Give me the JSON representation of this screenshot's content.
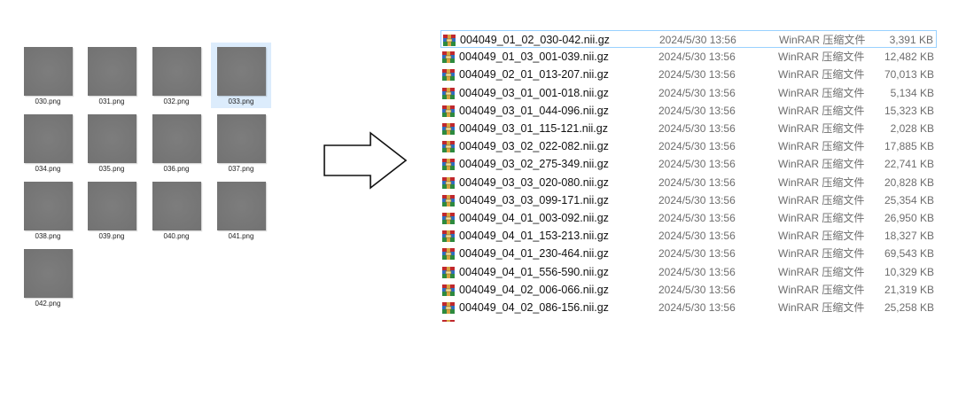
{
  "thumbnails": [
    {
      "label": "030.png",
      "selected": false
    },
    {
      "label": "031.png",
      "selected": false
    },
    {
      "label": "032.png",
      "selected": false
    },
    {
      "label": "033.png",
      "selected": true
    },
    {
      "label": "034.png",
      "selected": false
    },
    {
      "label": "035.png",
      "selected": false
    },
    {
      "label": "036.png",
      "selected": false
    },
    {
      "label": "037.png",
      "selected": false
    },
    {
      "label": "038.png",
      "selected": false
    },
    {
      "label": "039.png",
      "selected": false
    },
    {
      "label": "040.png",
      "selected": false
    },
    {
      "label": "041.png",
      "selected": false
    },
    {
      "label": "042.png",
      "selected": false
    }
  ],
  "arrow_icon": "right-arrow-outline",
  "file_icon": "winrar-archive-icon",
  "files": [
    {
      "name": "004049_01_02_030-042.nii.gz",
      "date": "2024/5/30 13:56",
      "type": "WinRAR 压缩文件",
      "size": "3,391 KB"
    },
    {
      "name": "004049_01_03_001-039.nii.gz",
      "date": "2024/5/30 13:56",
      "type": "WinRAR 压缩文件",
      "size": "12,482 KB"
    },
    {
      "name": "004049_02_01_013-207.nii.gz",
      "date": "2024/5/30 13:56",
      "type": "WinRAR 压缩文件",
      "size": "70,013 KB"
    },
    {
      "name": "004049_03_01_001-018.nii.gz",
      "date": "2024/5/30 13:56",
      "type": "WinRAR 压缩文件",
      "size": "5,134 KB"
    },
    {
      "name": "004049_03_01_044-096.nii.gz",
      "date": "2024/5/30 13:56",
      "type": "WinRAR 压缩文件",
      "size": "15,323 KB"
    },
    {
      "name": "004049_03_01_115-121.nii.gz",
      "date": "2024/5/30 13:56",
      "type": "WinRAR 压缩文件",
      "size": "2,028 KB"
    },
    {
      "name": "004049_03_02_022-082.nii.gz",
      "date": "2024/5/30 13:56",
      "type": "WinRAR 压缩文件",
      "size": "17,885 KB"
    },
    {
      "name": "004049_03_02_275-349.nii.gz",
      "date": "2024/5/30 13:56",
      "type": "WinRAR 压缩文件",
      "size": "22,741 KB"
    },
    {
      "name": "004049_03_03_020-080.nii.gz",
      "date": "2024/5/30 13:56",
      "type": "WinRAR 压缩文件",
      "size": "20,828 KB"
    },
    {
      "name": "004049_03_03_099-171.nii.gz",
      "date": "2024/5/30 13:56",
      "type": "WinRAR 压缩文件",
      "size": "25,354 KB"
    },
    {
      "name": "004049_04_01_003-092.nii.gz",
      "date": "2024/5/30 13:56",
      "type": "WinRAR 压缩文件",
      "size": "26,950 KB"
    },
    {
      "name": "004049_04_01_153-213.nii.gz",
      "date": "2024/5/30 13:56",
      "type": "WinRAR 压缩文件",
      "size": "18,327 KB"
    },
    {
      "name": "004049_04_01_230-464.nii.gz",
      "date": "2024/5/30 13:56",
      "type": "WinRAR 压缩文件",
      "size": "69,543 KB"
    },
    {
      "name": "004049_04_01_556-590.nii.gz",
      "date": "2024/5/30 13:56",
      "type": "WinRAR 压缩文件",
      "size": "10,329 KB"
    },
    {
      "name": "004049_04_02_006-066.nii.gz",
      "date": "2024/5/30 13:56",
      "type": "WinRAR 压缩文件",
      "size": "21,319 KB"
    },
    {
      "name": "004049_04_02_086-156.nii.gz",
      "date": "2024/5/30 13:56",
      "type": "WinRAR 压缩文件",
      "size": "25,258 KB"
    }
  ],
  "colors": {
    "selection_bg": "#dcecfc",
    "row_focus_border": "#99d1ff",
    "thumbnail_gray": "#787878",
    "secondary_text": "#6d6d6d"
  }
}
